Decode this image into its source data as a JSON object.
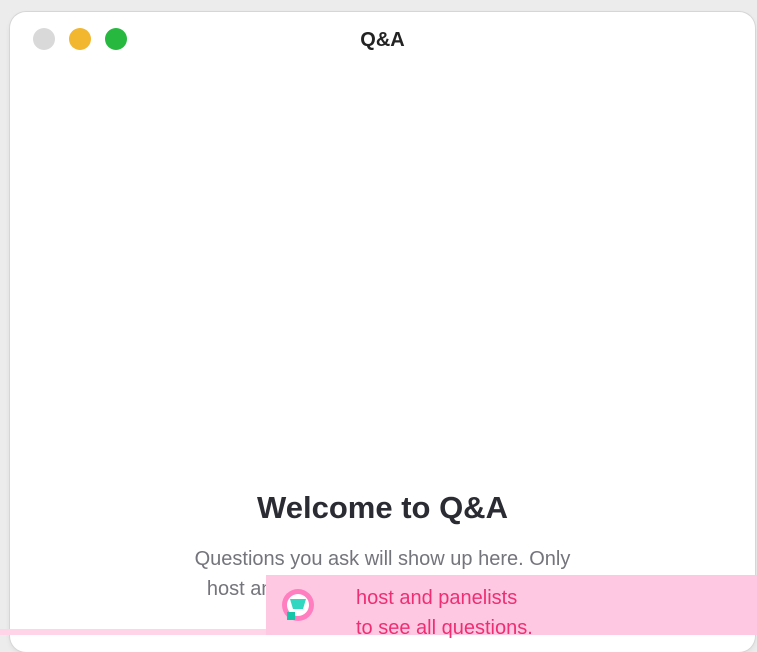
{
  "window": {
    "title": "Q&A",
    "controls": {
      "close": "close-button",
      "minimize": "minimize-button",
      "maximize": "zoom-button"
    },
    "colors": {
      "close": "#d9d9d9",
      "minimize": "#f2b62f",
      "maximize": "#27b93f"
    }
  },
  "empty_state": {
    "heading": "Welcome to Q&A",
    "body": "Questions you ask will show up here. Only host and panelists will be able to see all questions."
  },
  "overlay_banner": {
    "line1": "host and panelists",
    "line2": "to see all questions.",
    "color": "#ee2e73",
    "background": "#ffc8e2",
    "icon": "badge-icon"
  }
}
